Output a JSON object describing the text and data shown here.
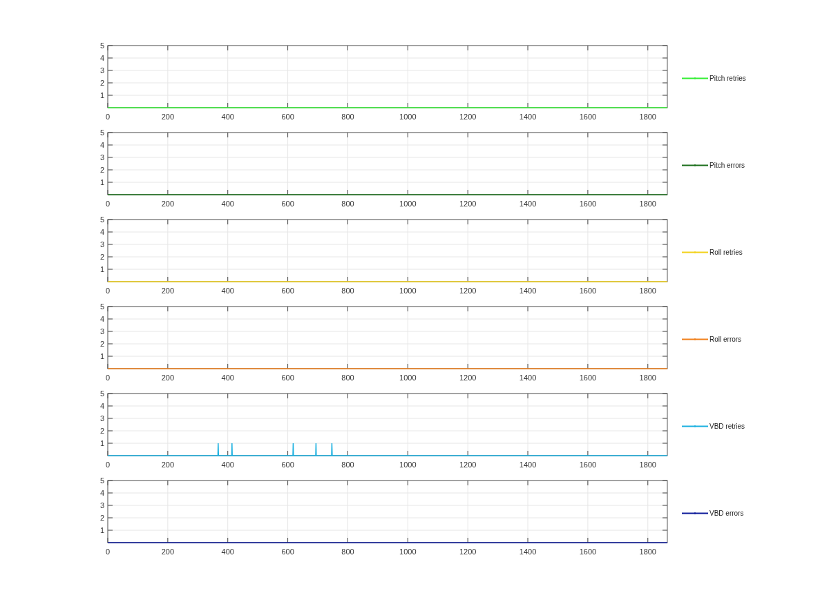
{
  "panels": [
    {
      "chart_data": {
        "type": "line",
        "grid": true,
        "xlim": [
          0,
          1865
        ],
        "ylim": [
          0,
          5
        ],
        "xticks": [
          0,
          200,
          400,
          600,
          800,
          1000,
          1200,
          1400,
          1600,
          1800
        ],
        "yticks": [
          1,
          2,
          3,
          4,
          5
        ],
        "x": [
          0,
          1865
        ],
        "series": [
          {
            "name": "Pitch retries",
            "color": "#33ee33",
            "values": [
              0,
              0
            ]
          }
        ]
      }
    },
    {
      "chart_data": {
        "type": "line",
        "grid": true,
        "xlim": [
          0,
          1865
        ],
        "ylim": [
          0,
          5
        ],
        "xticks": [
          0,
          200,
          400,
          600,
          800,
          1000,
          1200,
          1400,
          1600,
          1800
        ],
        "yticks": [
          1,
          2,
          3,
          4,
          5
        ],
        "x": [
          0,
          1865
        ],
        "series": [
          {
            "name": "Pitch errors",
            "color": "#1a6e1a",
            "values": [
              0,
              0
            ]
          }
        ]
      }
    },
    {
      "chart_data": {
        "type": "line",
        "grid": true,
        "xlim": [
          0,
          1865
        ],
        "ylim": [
          0,
          5
        ],
        "xticks": [
          0,
          200,
          400,
          600,
          800,
          1000,
          1200,
          1400,
          1600,
          1800
        ],
        "yticks": [
          1,
          2,
          3,
          4,
          5
        ],
        "x": [
          0,
          1865
        ],
        "series": [
          {
            "name": "Roll retries",
            "color": "#f2d21a",
            "values": [
              0,
              0
            ]
          }
        ]
      }
    },
    {
      "chart_data": {
        "type": "line",
        "grid": true,
        "xlim": [
          0,
          1865
        ],
        "ylim": [
          0,
          5
        ],
        "xticks": [
          0,
          200,
          400,
          600,
          800,
          1000,
          1200,
          1400,
          1600,
          1800
        ],
        "yticks": [
          1,
          2,
          3,
          4,
          5
        ],
        "x": [
          0,
          1865
        ],
        "series": [
          {
            "name": "Roll errors",
            "color": "#f07f1a",
            "values": [
              0,
              0
            ]
          }
        ]
      }
    },
    {
      "chart_data": {
        "type": "line",
        "grid": true,
        "xlim": [
          0,
          1865
        ],
        "ylim": [
          0,
          5
        ],
        "xticks": [
          0,
          200,
          400,
          600,
          800,
          1000,
          1200,
          1400,
          1600,
          1800
        ],
        "yticks": [
          1,
          2,
          3,
          4,
          5
        ],
        "x": [
          0,
          367,
          368,
          369,
          413,
          414,
          415,
          617,
          618,
          619,
          693,
          694,
          695,
          746,
          747,
          748,
          1865
        ],
        "series": [
          {
            "name": "VBD retries",
            "color": "#1ab0e0",
            "values": [
              0,
              0,
              1,
              0,
              0,
              1,
              0,
              0,
              1,
              0,
              0,
              1,
              0,
              0,
              1,
              0,
              0
            ]
          }
        ]
      }
    },
    {
      "chart_data": {
        "type": "line",
        "grid": true,
        "xlim": [
          0,
          1865
        ],
        "ylim": [
          0,
          5
        ],
        "xticks": [
          0,
          200,
          400,
          600,
          800,
          1000,
          1200,
          1400,
          1600,
          1800
        ],
        "yticks": [
          1,
          2,
          3,
          4,
          5
        ],
        "x": [
          0,
          1865
        ],
        "series": [
          {
            "name": "VBD errors",
            "color": "#0d1a99",
            "values": [
              0,
              0
            ]
          }
        ]
      }
    }
  ]
}
